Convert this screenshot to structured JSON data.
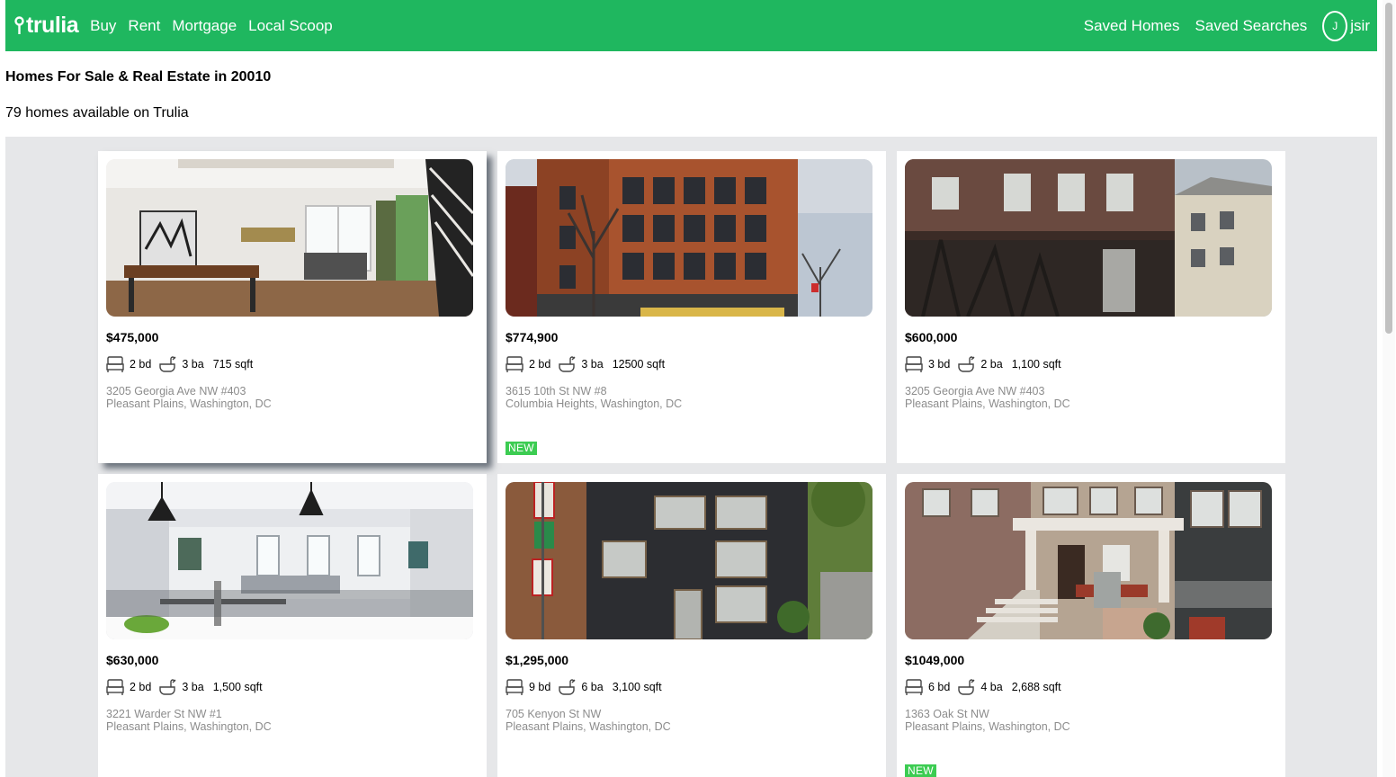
{
  "nav": {
    "logo_text": "trulia",
    "links": [
      "Buy",
      "Rent",
      "Mortgage",
      "Local Scoop"
    ],
    "right_links": [
      "Saved Homes",
      "Saved Searches"
    ],
    "user_initial": "J",
    "username": "jsir"
  },
  "page": {
    "title": "Homes For Sale & Real Estate in 20010",
    "count_text": "79 homes available on Trulia"
  },
  "colors": {
    "brand": "#1fb75f",
    "new_badge": "#3ccc52",
    "grid_background": "#e6e7e9"
  },
  "listings": [
    {
      "price": "$475,000",
      "beds": "2 bd",
      "baths": "3 ba",
      "sqft": "715 sqft",
      "address": "3205 Georgia Ave NW #403",
      "neighborhood": "Pleasant Plains, Washington, DC",
      "badge": "",
      "photo": "interior-dining"
    },
    {
      "price": "$774,900",
      "beds": "2 bd",
      "baths": "3 ba",
      "sqft": "12500 sqft",
      "address": "3615 10th St NW #8",
      "neighborhood": "Columbia Heights, Washington, DC",
      "badge": "NEW",
      "photo": "brick-building"
    },
    {
      "price": "$600,000",
      "beds": "3 bd",
      "baths": "2 ba",
      "sqft": "1,100 sqft",
      "address": "3205 Georgia Ave NW #403",
      "neighborhood": "Pleasant Plains, Washington, DC",
      "badge": "",
      "photo": "dark-rowhouse"
    },
    {
      "price": "$630,000",
      "beds": "2 bd",
      "baths": "3 ba",
      "sqft": "1,500 sqft",
      "address": "3221 Warder St NW #1",
      "neighborhood": "Pleasant Plains, Washington, DC",
      "badge": "",
      "photo": "interior-living"
    },
    {
      "price": "$1,295,000",
      "beds": "9 bd",
      "baths": "6 ba",
      "sqft": "3,100 sqft",
      "address": "705 Kenyon St NW",
      "neighborhood": "Pleasant Plains, Washington, DC",
      "badge": "",
      "photo": "dark-building"
    },
    {
      "price": "$1049,000",
      "beds": "6 bd",
      "baths": "4 ba",
      "sqft": "2,688 sqft",
      "address": "1363 Oak St NW",
      "neighborhood": "Pleasant Plains, Washington, DC",
      "badge": "NEW",
      "photo": "porch-house"
    }
  ]
}
